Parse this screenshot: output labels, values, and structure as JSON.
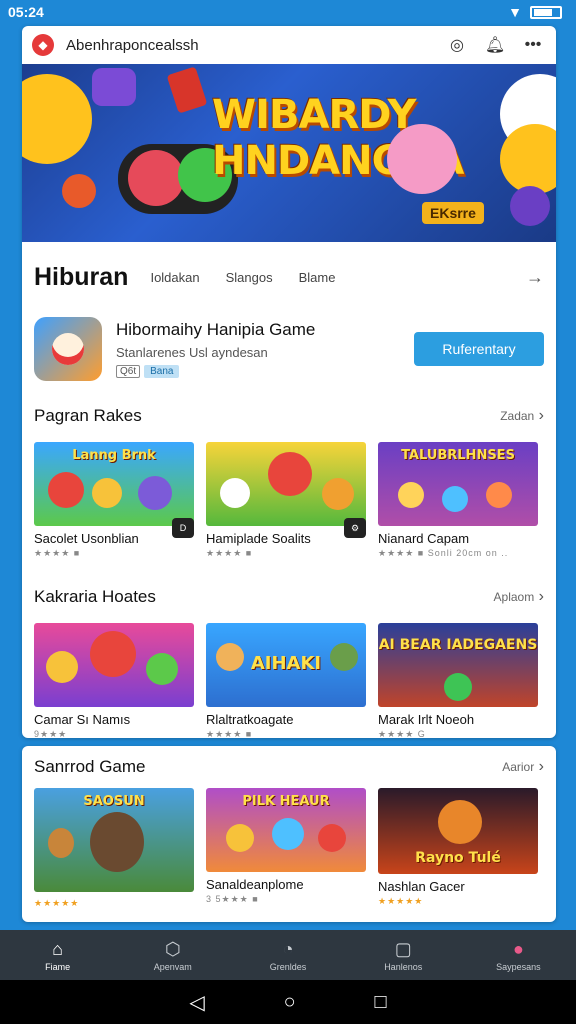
{
  "status": {
    "time": "05:24"
  },
  "topbar": {
    "url": "Abenhraponcealssh"
  },
  "banner": {
    "title_line1": "WIBARDY",
    "title_line2": "HNDANGAA",
    "chip": "EKsrre"
  },
  "hiburan": {
    "title": "Hiburan",
    "tabs": [
      "Ioldakan",
      "Slangos",
      "Blame"
    ]
  },
  "featured": {
    "name": "Hibormaihy Hanipia Game",
    "subtitle": "Stanlarenes Usl ayndesan",
    "tag1": "Q6t",
    "tag2": "Bana",
    "button": "Ruferentary"
  },
  "sections": [
    {
      "title": "Pagran Rakes",
      "more": "Zadan",
      "tiles": [
        {
          "name": "Sacolet Usonblian",
          "rating": "★★★★ ■",
          "thumb": "Lanng Brnk",
          "badge": "D"
        },
        {
          "name": "Hamiplade Soalits",
          "rating": "★★★★ ■",
          "thumb": "",
          "badge": "⚙"
        },
        {
          "name": "Nianard Capam",
          "rating": "★★★★ ■ Sonli 20cm on ..",
          "thumb": "TALUBRLHNSES",
          "badge": ""
        }
      ]
    },
    {
      "title": "Kakraria Hoates",
      "more": "Aplaom",
      "tiles": [
        {
          "name": "Camar Sı Namıs",
          "rating": "9★★★",
          "thumb": "",
          "badge": ""
        },
        {
          "name": "Rlaltratkoagate",
          "rating": "★★★★ ■",
          "thumb": "AIHAKI",
          "badge": ""
        },
        {
          "name": "Marak Irlt Noeoh",
          "rating": "★★★★ G",
          "thumb": "AI BEAR IADEGAENS",
          "badge": ""
        }
      ]
    },
    {
      "title": "Sanrrod Game",
      "more": "Aarior",
      "tiles": [
        {
          "name": "",
          "rating": "★★★★★",
          "thumb": "SAOSUN",
          "badge": ""
        },
        {
          "name": "Sanaldeanplome",
          "rating": "3 5★★★ ■",
          "thumb": "PILK HEAUR",
          "badge": ""
        },
        {
          "name": "Nashlan Gacer",
          "rating": "★★★★★",
          "thumb": "Rayno Tulé",
          "badge": ""
        }
      ]
    }
  ],
  "nav": [
    {
      "label": "Fiame",
      "icon": "⌂"
    },
    {
      "label": "Apenvam",
      "icon": "⬡"
    },
    {
      "label": "Grenldes",
      "icon": "◔"
    },
    {
      "label": "Hanlenos",
      "icon": "▢"
    },
    {
      "label": "Saypesans",
      "icon": "●"
    }
  ],
  "colors": {
    "accent": "#2c9ee0",
    "header": "#1e88d6",
    "nav_bg": "#2e3740"
  }
}
